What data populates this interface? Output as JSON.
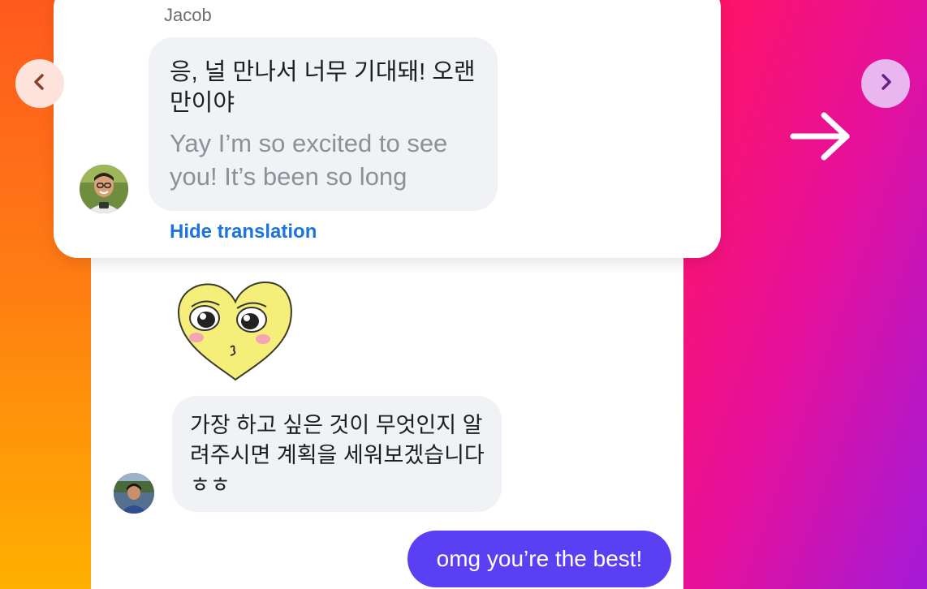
{
  "conversation": {
    "sender_name": "Jacob",
    "message_original": "응, 널 만나서 너무 기대돼! 오랜만이야",
    "message_translation": "Yay I’m so excited to see you! It’s been so long",
    "hide_translation_label": "Hide translation",
    "message_2": "가장 하고 싶은 것이 무엇인지 알려주시면 계획을 세워보겠습니다 ㅎㅎ",
    "my_message": "omg you’re the best!"
  },
  "icons": {
    "prev": "chevron-left-icon",
    "next": "chevron-right-icon",
    "arrow": "arrow-right-icon",
    "sticker": "heart-face-sticker"
  },
  "colors": {
    "my_bubble": "#5a40f2",
    "link": "#1c74e0",
    "incoming_bubble": "#f0f2f5"
  }
}
